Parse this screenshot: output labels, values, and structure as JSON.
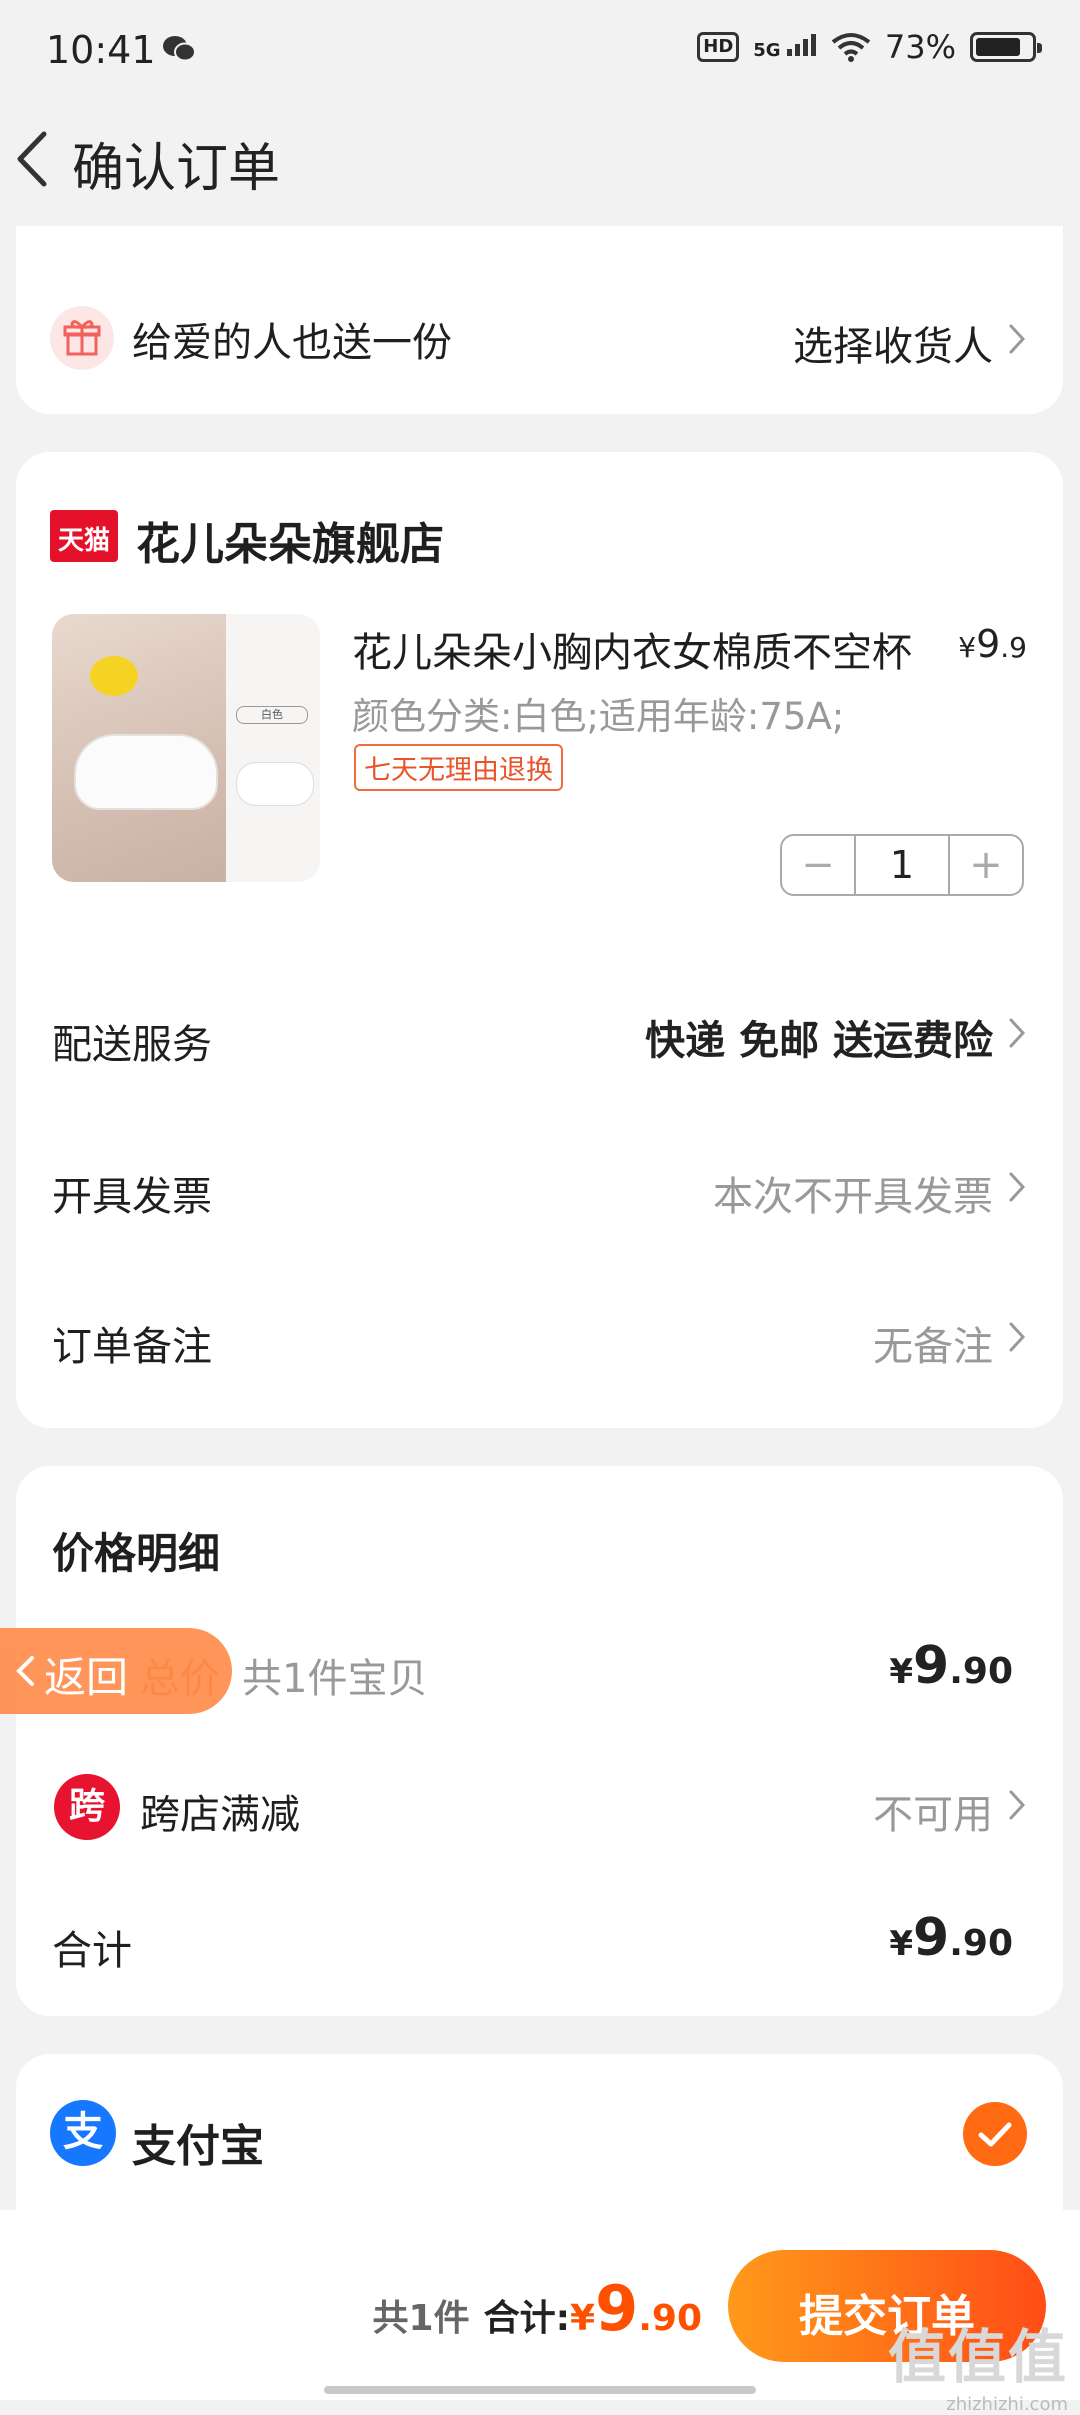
{
  "status_bar": {
    "time": "10:41",
    "hd": "HD",
    "network": "5G",
    "battery": "73%"
  },
  "header": {
    "title": "确认订单"
  },
  "gift": {
    "label": "给爱的人也送一份",
    "action": "选择收货人"
  },
  "store": {
    "logo_text": "天猫",
    "name": "花儿朵朵旗舰店",
    "product": {
      "title": "花儿朵朵小胸内衣女棉质不空杯",
      "price_symbol": "¥",
      "price_int": "9",
      "price_dec": ".9",
      "spec": "颜色分类:白色;适用年龄:75A;",
      "tag": "七天无理由退换",
      "image_tag": "白色",
      "quantity": "1"
    },
    "delivery": {
      "label": "配送服务",
      "value": "快递 免邮 送运费险"
    },
    "invoice": {
      "label": "开具发票",
      "value": "本次不开具发票"
    },
    "note": {
      "label": "订单备注",
      "value": "无备注"
    }
  },
  "price_detail": {
    "title": "价格明细",
    "total_label": "总价",
    "total_count": "共1件宝贝",
    "total_price": {
      "symbol": "¥",
      "int": "9",
      "dec": ".90"
    },
    "cross_store": {
      "icon": "跨",
      "label": "跨店满减",
      "value": "不可用"
    },
    "sum_label": "合计",
    "sum_price": {
      "symbol": "¥",
      "int": "9",
      "dec": ".90"
    }
  },
  "float_back": {
    "label": "返回"
  },
  "payment": {
    "icon": "支",
    "label": "支付宝"
  },
  "bottom": {
    "count": "共1件",
    "sum_label": "合计:",
    "symbol": "¥",
    "int": "9",
    "dec": ".90",
    "submit": "提交订单"
  },
  "watermark": {
    "big": "值值值",
    "small": "zhizhizhi.com"
  },
  "colors": {
    "accent": "#ff5000",
    "price": "#ff5000",
    "tmall": "#e5112b",
    "alipay": "#1677ff"
  }
}
